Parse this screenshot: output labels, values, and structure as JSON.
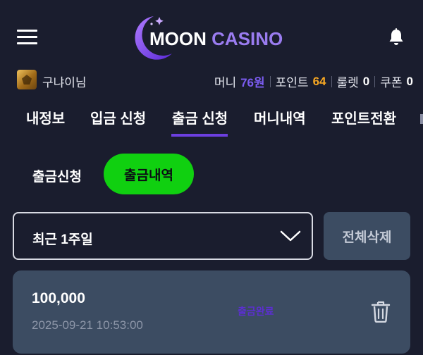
{
  "header": {
    "logo_word1": "MOON",
    "logo_word2": "CASINO",
    "menu_icon": "hamburger-menu-icon",
    "bell_icon": "bell-icon"
  },
  "user": {
    "name": "구냐이님",
    "money_label": "머니",
    "money_value": "76원",
    "point_label": "포인트",
    "point_value": "64",
    "roulette_label": "룰렛",
    "roulette_value": "0",
    "coupon_label": "쿠폰",
    "coupon_value": "0"
  },
  "tabs": [
    {
      "label": "내정보",
      "active": false
    },
    {
      "label": "입금 신청",
      "active": false
    },
    {
      "label": "출금 신청",
      "active": true
    },
    {
      "label": "머니내역",
      "active": false
    },
    {
      "label": "포인트전환",
      "active": false
    }
  ],
  "subtabs": {
    "request_label": "출금신청",
    "history_label": "출금내역",
    "active": "출금내역"
  },
  "filter": {
    "period_value": "최근 1주일",
    "delete_all_label": "전체삭제"
  },
  "records": [
    {
      "amount": "100,000",
      "datetime": "2025-09-21 10:53:00",
      "status": "출금완료"
    }
  ],
  "colors": {
    "background": "#1a1d2e",
    "accent_purple": "#6c3fe0",
    "active_green": "#10d010",
    "money_color": "#7b5cf0",
    "point_color": "#f5a623",
    "card_bg": "#3c4c62"
  }
}
